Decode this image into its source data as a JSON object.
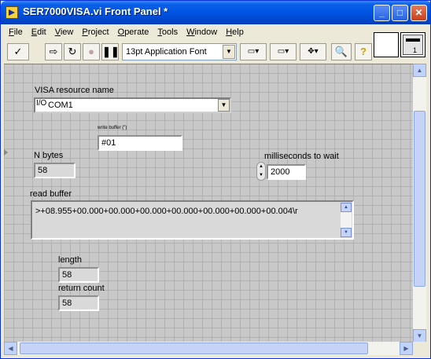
{
  "window": {
    "title": "SER7000VISA.vi Front Panel *"
  },
  "title_buttons": {
    "minimize": "_",
    "maximize": "□",
    "close": "✕"
  },
  "menu": [
    "File",
    "Edit",
    "View",
    "Project",
    "Operate",
    "Tools",
    "Window",
    "Help"
  ],
  "toolbar": {
    "run": "✓",
    "run_continuously": "⇨",
    "loop": "↻",
    "abort": "●",
    "pause": "❚❚",
    "font": "13pt Application Font",
    "align": "▭▾",
    "distribute": "▭▾",
    "reorder": "✥▾",
    "zoom": "🔍",
    "help": "?"
  },
  "connector": {
    "pane_number": "1"
  },
  "panel": {
    "visa_label": "VISA resource name",
    "visa_io": "I/O",
    "visa_value": "COM1",
    "write_label": "write buffer (\")",
    "write_value": "#01",
    "nbytes_label": "N bytes",
    "nbytes_value": "58",
    "timeout_label": "milliseconds to wait",
    "timeout_value": "2000",
    "read_label": "read buffer",
    "read_value": ">+08.955+00.000+00.000+00.000+00.000+00.000+00.000+00.004\\r",
    "length_label": "length",
    "length_value": "58",
    "return_label": "return count",
    "return_value": "58"
  }
}
